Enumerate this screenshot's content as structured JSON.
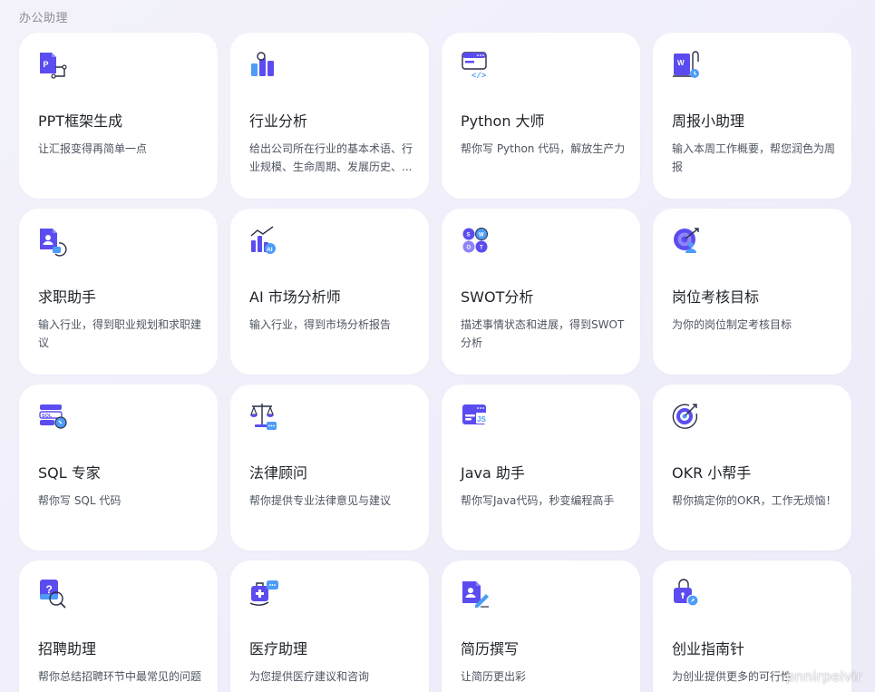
{
  "section": {
    "title": "办公助理"
  },
  "colors": {
    "primary": "#5b4cf0",
    "accent": "#4d9cf8",
    "card_bg": "#ffffff"
  },
  "cards": [
    {
      "title": "PPT框架生成",
      "desc": "让汇报变得再简单一点",
      "icon": "ppt-document-icon"
    },
    {
      "title": "行业分析",
      "desc": "给出公司所在行业的基本术语、行业规模、生命周期、发展历史、...",
      "icon": "bar-chart-icon"
    },
    {
      "title": "Python 大师",
      "desc": "帮你写 Python 代码，解放生产力",
      "icon": "code-window-icon"
    },
    {
      "title": "周报小助理",
      "desc": "输入本周工作概要，帮您润色为周报",
      "icon": "word-document-clock-icon"
    },
    {
      "title": "求职助手",
      "desc": "输入行业，得到职业规划和求职建议",
      "icon": "resume-person-icon"
    },
    {
      "title": "AI 市场分析师",
      "desc": "输入行业，得到市场分析报告",
      "icon": "ai-trend-chart-icon"
    },
    {
      "title": "SWOT分析",
      "desc": "描述事情状态和进展，得到SWOT分析",
      "icon": "swot-quadrant-icon"
    },
    {
      "title": "岗位考核目标",
      "desc": "为你的岗位制定考核目标",
      "icon": "target-person-icon"
    },
    {
      "title": "SQL 专家",
      "desc": "帮你写 SQL 代码",
      "icon": "sql-database-icon"
    },
    {
      "title": "法律顾问",
      "desc": "帮你提供专业法律意见与建议",
      "icon": "justice-scale-icon"
    },
    {
      "title": "Java 助手",
      "desc": "帮你写Java代码，秒变编程高手",
      "icon": "js-code-window-icon"
    },
    {
      "title": "OKR 小帮手",
      "desc": "帮你搞定你的OKR，工作无烦恼！",
      "icon": "okr-target-icon"
    },
    {
      "title": "招聘助理",
      "desc": "帮你总结招聘环节中最常见的问题",
      "icon": "question-search-icon"
    },
    {
      "title": "医疗助理",
      "desc": "为您提供医疗建议和咨询",
      "icon": "medical-kit-icon"
    },
    {
      "title": "简历撰写",
      "desc": "让简历更出彩",
      "icon": "resume-edit-icon"
    },
    {
      "title": "创业指南针",
      "desc": "为创业提供更多的可行性",
      "icon": "lock-compass-icon"
    }
  ],
  "watermark": {
    "text": "pnnirpeivir"
  }
}
